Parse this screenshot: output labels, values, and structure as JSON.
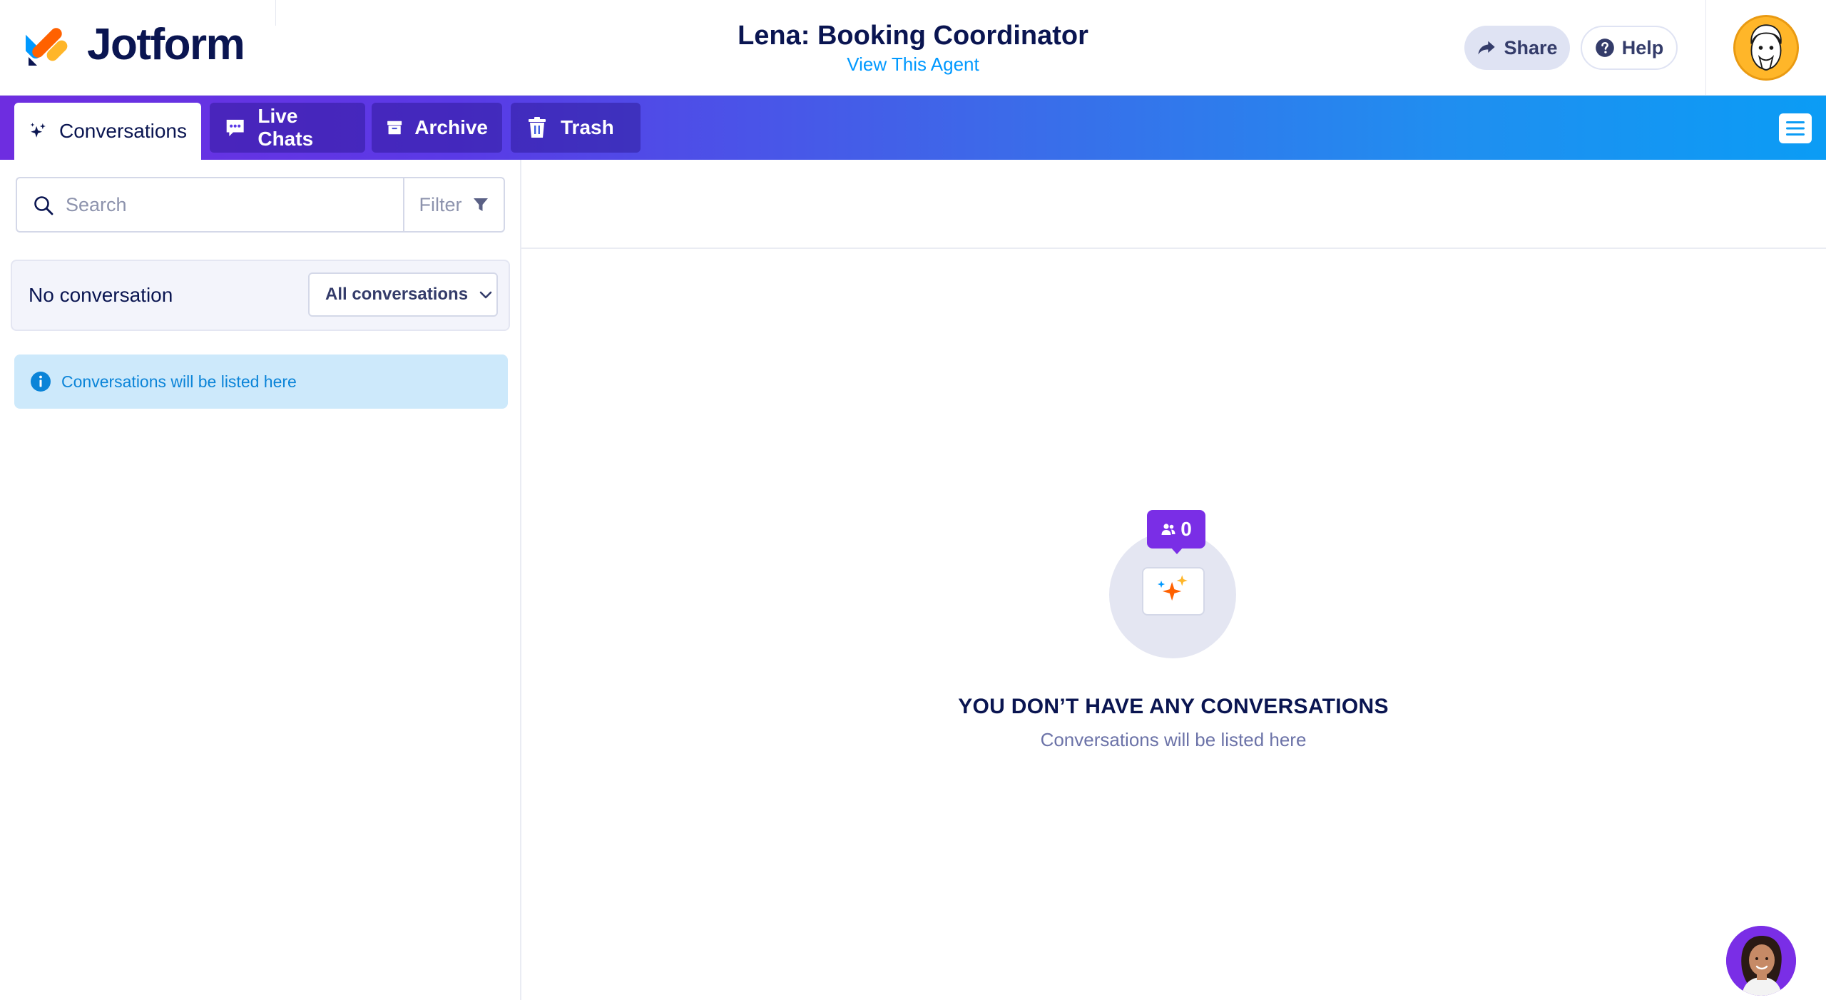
{
  "header": {
    "brand": "Jotform",
    "agent_title": "Lena: Booking Coordinator",
    "view_agent_link": "View This Agent",
    "share_label": "Share",
    "help_label": "Help"
  },
  "tabs": [
    {
      "label": "Conversations",
      "icon": "sparkle-icon",
      "active": true
    },
    {
      "label": "Live Chats",
      "icon": "chat-bubble-icon",
      "active": false
    },
    {
      "label": "Archive",
      "icon": "archive-box-icon",
      "active": false
    },
    {
      "label": "Trash",
      "icon": "trash-icon",
      "active": false
    }
  ],
  "left_panel": {
    "search_placeholder": "Search",
    "filter_label": "Filter",
    "status_text": "No conversation",
    "conversation_filter_selected": "All conversations",
    "info_message": "Conversations will be listed here"
  },
  "empty_state": {
    "count": "0",
    "title": "YOU DON’T HAVE ANY CONVERSATIONS",
    "subtitle": "Conversations will be listed here"
  },
  "colors": {
    "brand_navy": "#0a1551",
    "accent_blue": "#0099ff",
    "purple": "#7a2ee6",
    "tabbar_gradient_start": "#6e2de0",
    "tabbar_gradient_end": "#0b9cf5",
    "info_bg": "#cde9fb"
  }
}
